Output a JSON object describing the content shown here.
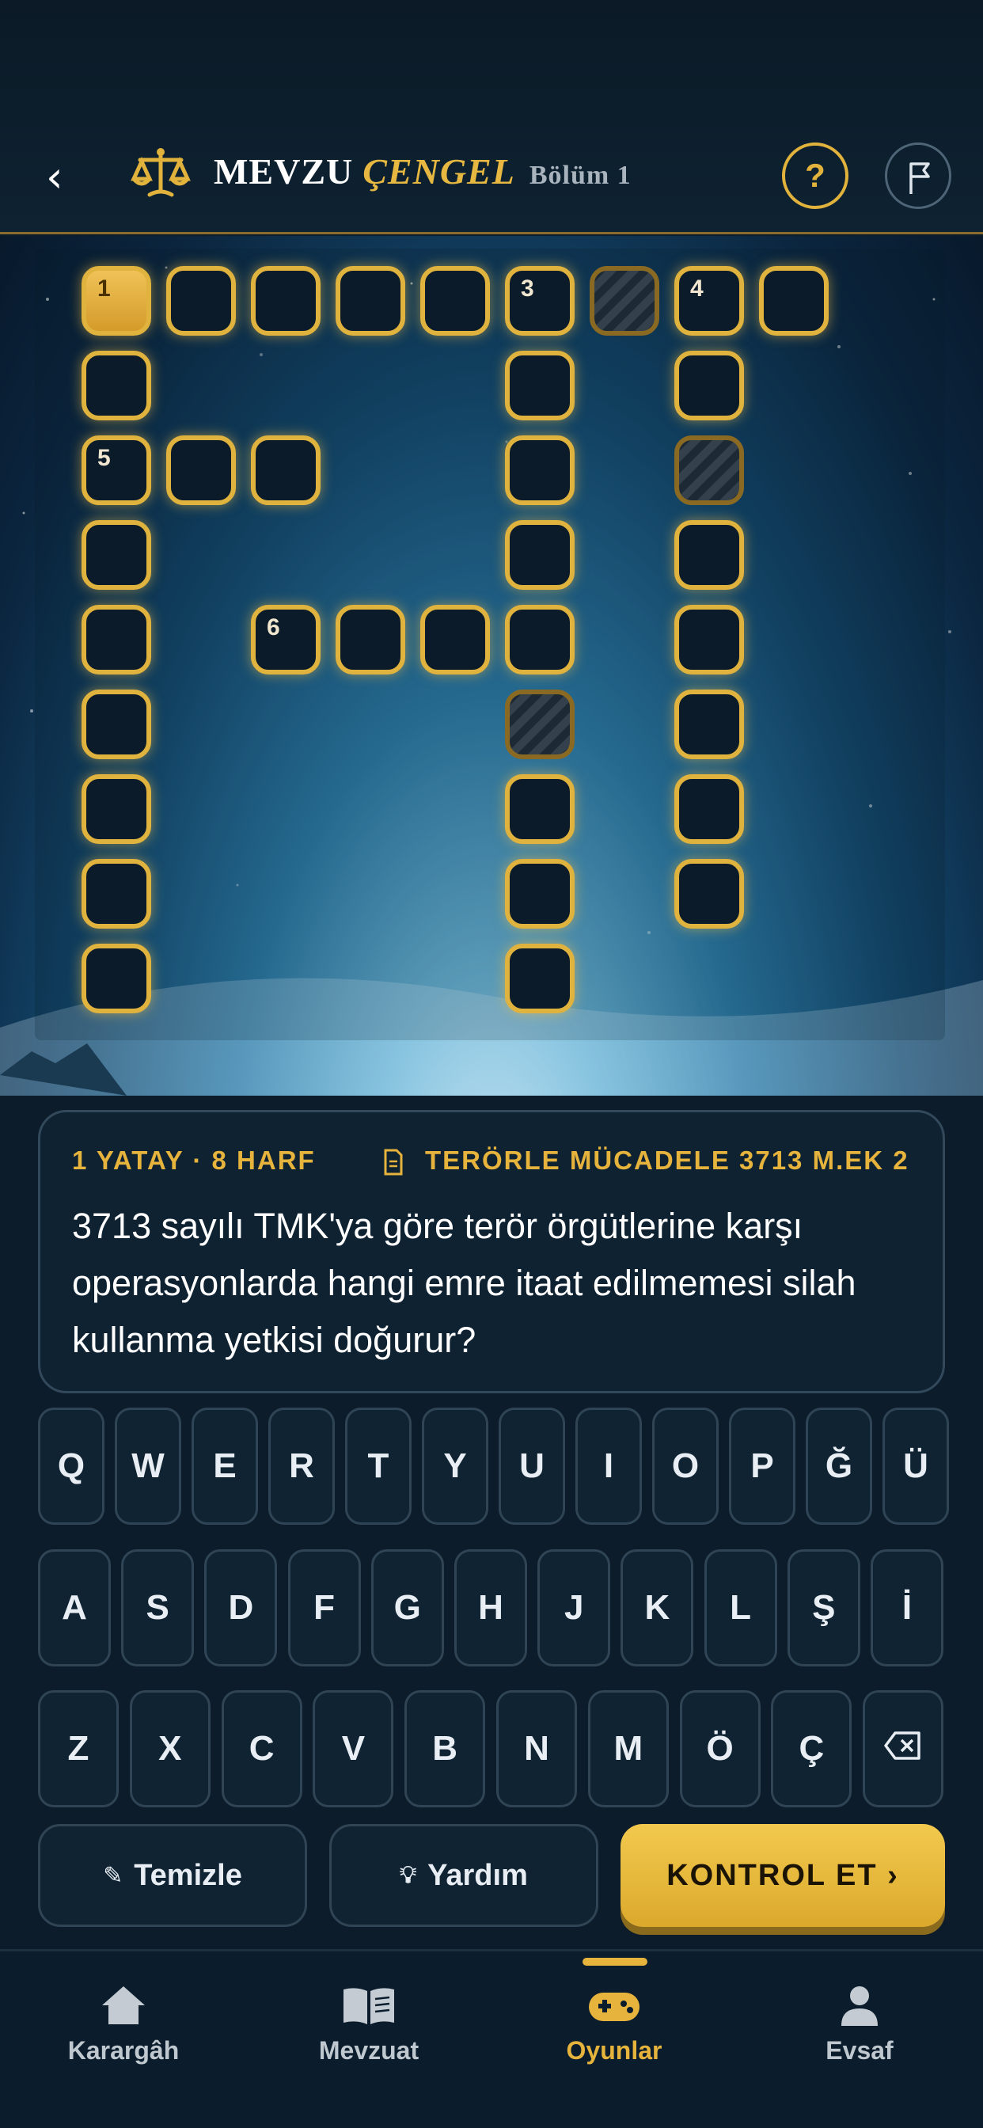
{
  "header": {
    "title_part1": "MEVZU",
    "title_part2": "ÇENGEL",
    "section_label": "Bölüm 1",
    "help_label": "?"
  },
  "board": {
    "cells": [
      {
        "num": "1",
        "active": true
      },
      {
        "num": ""
      },
      {
        "num": ""
      },
      {
        "num": ""
      },
      {
        "num": ""
      },
      {
        "num": "3"
      },
      {
        "blocked": true
      },
      {
        "num": "4"
      },
      {
        "num": ""
      },
      {
        "num": ""
      },
      {
        "num": ""
      },
      {
        "num": ""
      },
      {
        "num": "5"
      },
      {
        "num": ""
      },
      {
        "num": ""
      },
      {
        "num": ""
      },
      {
        "blocked": true
      },
      {
        "num": ""
      },
      {
        "num": ""
      },
      {
        "num": ""
      },
      {
        "num": ""
      },
      {
        "num": "6"
      },
      {
        "num": ""
      },
      {
        "num": ""
      },
      {
        "num": ""
      },
      {
        "num": ""
      },
      {
        "num": ""
      },
      {
        "blocked": true
      },
      {
        "num": ""
      },
      {
        "num": ""
      },
      {
        "num": ""
      },
      {
        "num": ""
      },
      {
        "num": ""
      },
      {
        "num": ""
      },
      {
        "num": ""
      },
      {
        "num": ""
      },
      {
        "num": ""
      }
    ]
  },
  "clue": {
    "meta": "1 YATAY · 8 HARF",
    "source": "TERÖRLE MÜCADELE 3713 M.EK 2",
    "text": "3713 sayılı TMK'ya göre terör örgütlerine karşı operasyonlarda hangi emre itaat edilmemesi silah kullanma yetkisi doğurur?"
  },
  "keyboard": {
    "row1": [
      "Q",
      "W",
      "E",
      "R",
      "T",
      "Y",
      "U",
      "I",
      "O",
      "P",
      "Ğ",
      "Ü"
    ],
    "row2": [
      "A",
      "S",
      "D",
      "F",
      "G",
      "H",
      "J",
      "K",
      "L",
      "Ş",
      "İ"
    ],
    "row3": [
      "Z",
      "X",
      "C",
      "V",
      "B",
      "N",
      "M",
      "Ö",
      "Ç"
    ]
  },
  "actions": {
    "clear_label": "Temizle",
    "hint_label": "Yardım",
    "check_label": "KONTROL ET ›"
  },
  "nav": {
    "items": [
      {
        "label": "Karargâh",
        "icon": "home-icon"
      },
      {
        "label": "Mevzuat",
        "icon": "book-icon"
      },
      {
        "label": "Oyunlar",
        "icon": "gamepad-icon"
      },
      {
        "label": "Evsaf",
        "icon": "user-icon"
      }
    ]
  },
  "colors": {
    "accent": "#e6b33c",
    "background": "#0c1c2a"
  }
}
